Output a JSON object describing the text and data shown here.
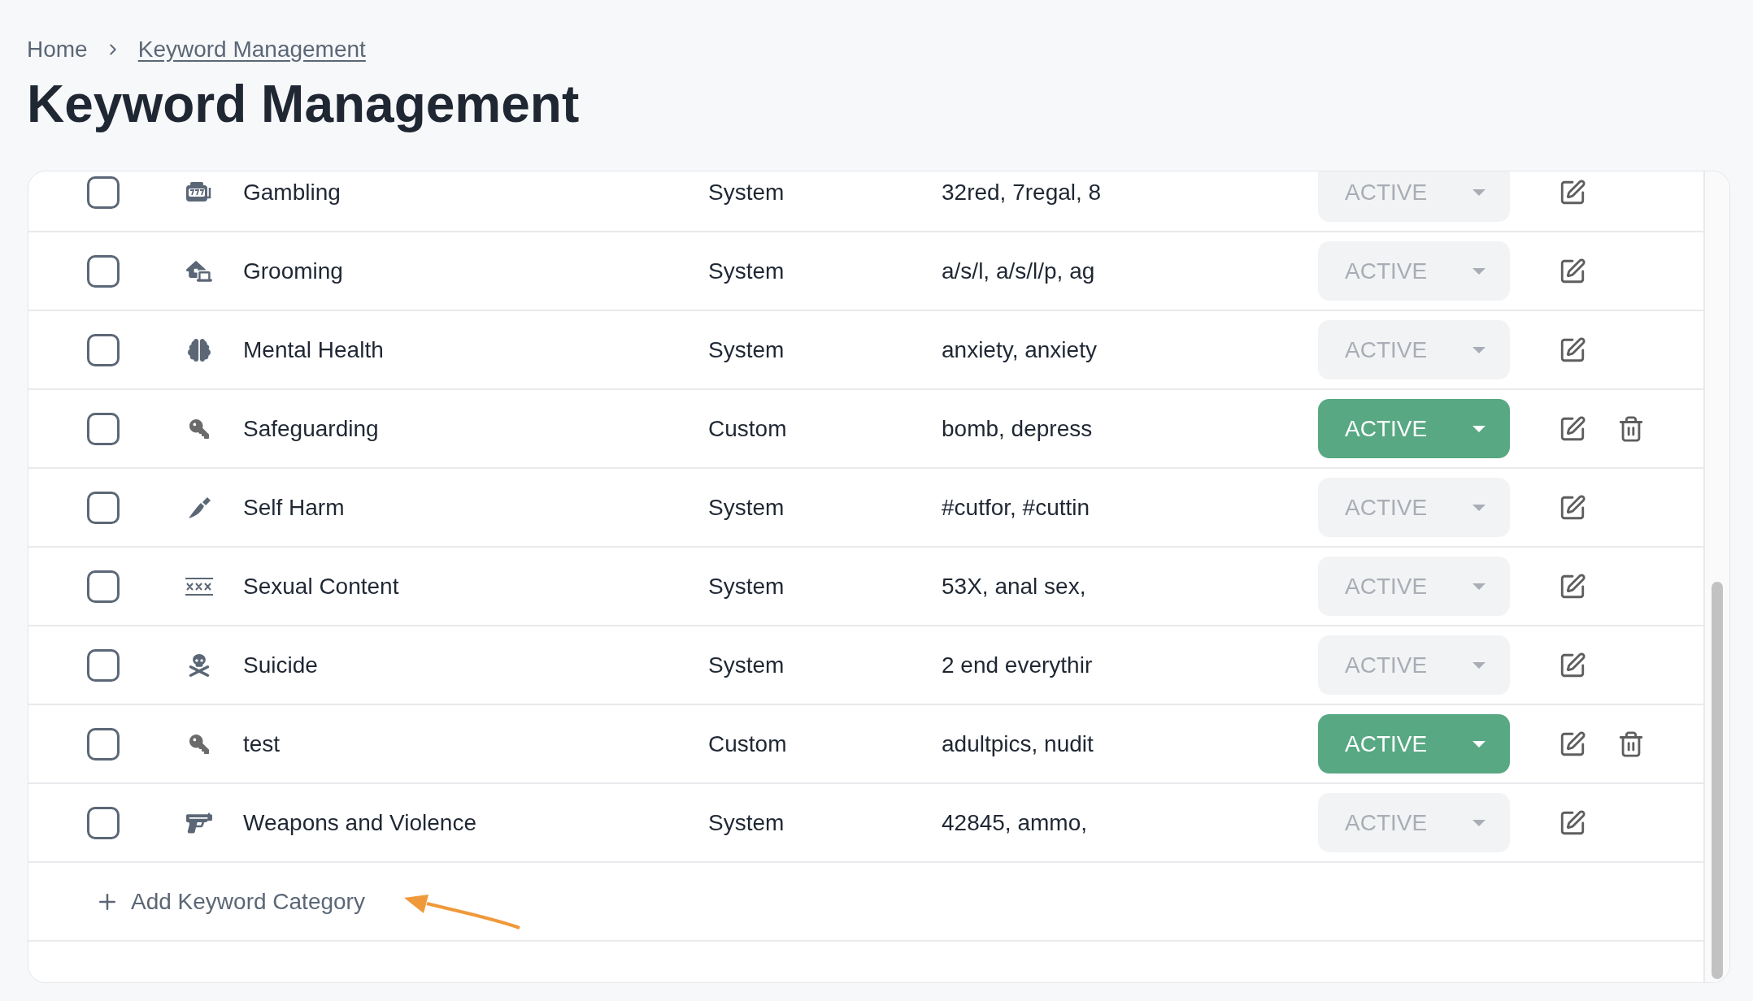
{
  "breadcrumb": {
    "home": "Home",
    "current": "Keyword Management"
  },
  "title": "Keyword Management",
  "rows": [
    {
      "checked": false,
      "name": "Gambling",
      "type": "System",
      "keywords": "32red, 7regal, 8",
      "status": "ACTIVE",
      "disabled": true,
      "deletable": false
    },
    {
      "checked": false,
      "name": "Grooming",
      "type": "System",
      "keywords": "a/s/l, a/s/l/p, ag",
      "status": "ACTIVE",
      "disabled": true,
      "deletable": false
    },
    {
      "checked": false,
      "name": "Mental Health",
      "type": "System",
      "keywords": "anxiety, anxiety",
      "status": "ACTIVE",
      "disabled": true,
      "deletable": false
    },
    {
      "checked": false,
      "name": "Safeguarding",
      "type": "Custom",
      "keywords": "bomb, depress",
      "status": "ACTIVE",
      "disabled": false,
      "deletable": true
    },
    {
      "checked": false,
      "name": "Self Harm",
      "type": "System",
      "keywords": "#cutfor, #cuttin",
      "status": "ACTIVE",
      "disabled": true,
      "deletable": false
    },
    {
      "checked": false,
      "name": "Sexual Content",
      "type": "System",
      "keywords": "53X, anal sex,",
      "status": "ACTIVE",
      "disabled": true,
      "deletable": false
    },
    {
      "checked": false,
      "name": "Suicide",
      "type": "System",
      "keywords": "2 end everythir",
      "status": "ACTIVE",
      "disabled": true,
      "deletable": false
    },
    {
      "checked": false,
      "name": "test",
      "type": "Custom",
      "keywords": "adultpics, nudit",
      "status": "ACTIVE",
      "disabled": false,
      "deletable": true
    },
    {
      "checked": false,
      "name": "Weapons and Violence",
      "type": "System",
      "keywords": "42845, ammo,",
      "status": "ACTIVE",
      "disabled": true,
      "deletable": false
    }
  ],
  "add_button": "Add Keyword Category"
}
